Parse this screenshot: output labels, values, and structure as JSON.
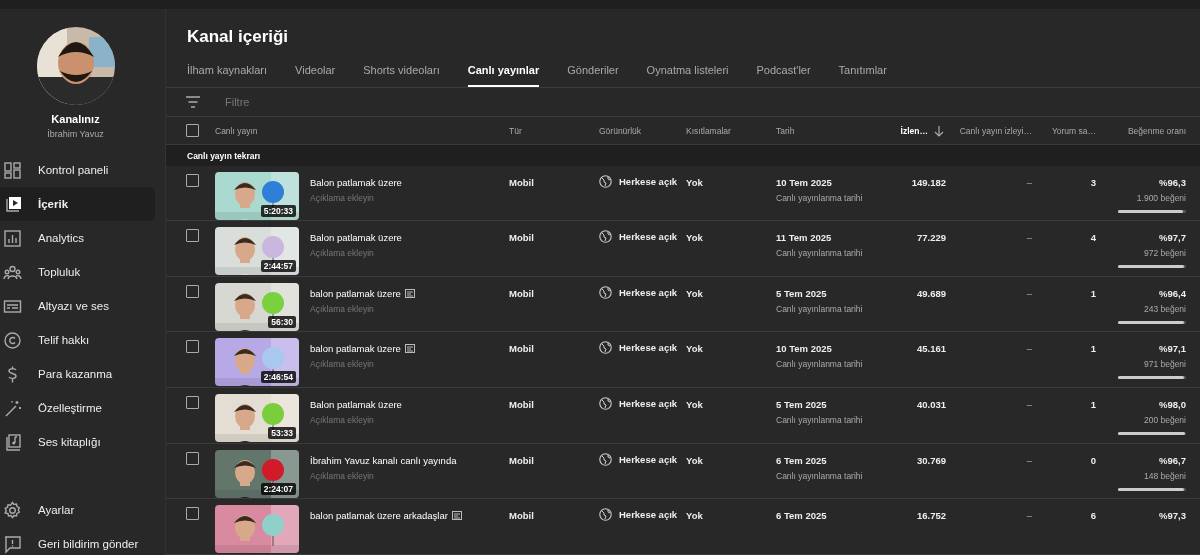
{
  "sidebar": {
    "channel_label": "Kanalınız",
    "channel_name": "İbrahim Yavuz",
    "items": [
      {
        "label": "Kontrol paneli",
        "selected": false
      },
      {
        "label": "İçerik",
        "selected": true
      },
      {
        "label": "Analytics",
        "selected": false
      },
      {
        "label": "Topluluk",
        "selected": false
      },
      {
        "label": "Altyazı ve ses",
        "selected": false
      },
      {
        "label": "Telif hakkı",
        "selected": false
      },
      {
        "label": "Para kazanma",
        "selected": false
      },
      {
        "label": "Özelleştirme",
        "selected": false
      },
      {
        "label": "Ses kitaplığı",
        "selected": false
      }
    ],
    "footer_items": [
      {
        "label": "Ayarlar"
      },
      {
        "label": "Geri bildirim gönder"
      }
    ]
  },
  "page_title": "Kanal içeriği",
  "tabs": [
    {
      "label": "İlham kaynakları",
      "selected": false
    },
    {
      "label": "Videolar",
      "selected": false
    },
    {
      "label": "Shorts videoları",
      "selected": false
    },
    {
      "label": "Canlı yayınlar",
      "selected": true
    },
    {
      "label": "Gönderiler",
      "selected": false
    },
    {
      "label": "Oynatma listeleri",
      "selected": false
    },
    {
      "label": "Podcast'ler",
      "selected": false
    },
    {
      "label": "Tanıtımlar",
      "selected": false
    }
  ],
  "filter": {
    "placeholder": "Filtre"
  },
  "table": {
    "select_all_checked": false,
    "columns": [
      {
        "label": "Canlı yayın",
        "sorted": false
      },
      {
        "label": "Tür",
        "sorted": false
      },
      {
        "label": "Görünürlük",
        "sorted": false
      },
      {
        "label": "Kısıtlamalar",
        "sorted": false
      },
      {
        "label": "Tarih",
        "sorted": false
      },
      {
        "label": "İzlen…",
        "sorted": true
      },
      {
        "label": "Canlı yayın izleyi…",
        "sorted": false
      },
      {
        "label": "Yorum sa…",
        "sorted": false
      },
      {
        "label": "Beğenme oranı",
        "sorted": false
      }
    ],
    "section": "Canlı yayın tekrarı",
    "rows": [
      {
        "checked": false,
        "duration": "5:20:33",
        "title": "Balon patlamak üzere",
        "emoji": false,
        "description": "Açıklama ekleyin",
        "type": "Mobil",
        "visibility": "Herkese açık",
        "restrictions": "Yok",
        "date": "10 Tem 2025",
        "date_note": "Canlı yayınlanma tarihi",
        "views": "149.182",
        "live_viewers": "–",
        "comments": "3",
        "like_ratio": "%96,3",
        "likes": "1.900 beğeni",
        "level": 0.963
      },
      {
        "checked": false,
        "duration": "2:44:57",
        "title": "Balon patlamak üzere",
        "emoji": false,
        "description": "Açıklama ekleyin",
        "type": "Mobil",
        "visibility": "Herkese açık",
        "restrictions": "Yok",
        "date": "11 Tem 2025",
        "date_note": "Canlı yayınlanma tarihi",
        "views": "77.229",
        "live_viewers": "–",
        "comments": "4",
        "like_ratio": "%97,7",
        "likes": "972 beğeni",
        "level": 0.977
      },
      {
        "checked": false,
        "duration": "56:30",
        "title": "balon patlamak üzere",
        "emoji": true,
        "description": "Açıklama ekleyin",
        "type": "Mobil",
        "visibility": "Herkese açık",
        "restrictions": "Yok",
        "date": "5 Tem 2025",
        "date_note": "Canlı yayınlanma tarihi",
        "views": "49.689",
        "live_viewers": "–",
        "comments": "1",
        "like_ratio": "%96,4",
        "likes": "243 beğeni",
        "level": 0.964
      },
      {
        "checked": false,
        "duration": "2:46:54",
        "title": "balon patlamak üzere",
        "emoji": true,
        "description": "Açıklama ekleyin",
        "type": "Mobil",
        "visibility": "Herkese açık",
        "restrictions": "Yok",
        "date": "10 Tem 2025",
        "date_note": "Canlı yayınlanma tarihi",
        "views": "45.161",
        "live_viewers": "–",
        "comments": "1",
        "like_ratio": "%97,1",
        "likes": "971 beğeni",
        "level": 0.971
      },
      {
        "checked": false,
        "duration": "53:33",
        "title": "Balon patlamak üzere",
        "emoji": false,
        "description": "Açıklama ekleyin",
        "type": "Mobil",
        "visibility": "Herkese açık",
        "restrictions": "Yok",
        "date": "5 Tem 2025",
        "date_note": "Canlı yayınlanma tarihi",
        "views": "40.031",
        "live_viewers": "–",
        "comments": "1",
        "like_ratio": "%98,0",
        "likes": "200 beğeni",
        "level": 0.98
      },
      {
        "checked": false,
        "duration": "2:24:07",
        "title": "İbrahim Yavuz kanalı canlı yayında",
        "emoji": false,
        "description": "Açıklama ekleyin",
        "type": "Mobil",
        "visibility": "Herkese açık",
        "restrictions": "Yok",
        "date": "6 Tem 2025",
        "date_note": "Canlı yayınlanma tarihi",
        "views": "30.769",
        "live_viewers": "–",
        "comments": "0",
        "like_ratio": "%96,7",
        "likes": "148 beğeni",
        "level": 0.967
      },
      {
        "checked": false,
        "title": "balon patlamak üzere arkadaşlar",
        "emoji": true,
        "type": "Mobil",
        "visibility": "Herkese açık",
        "restrictions": "Yok",
        "date": "6 Tem 2025",
        "views": "16.752",
        "live_viewers": "–",
        "comments": "6",
        "like_ratio": "%97,3"
      }
    ]
  }
}
